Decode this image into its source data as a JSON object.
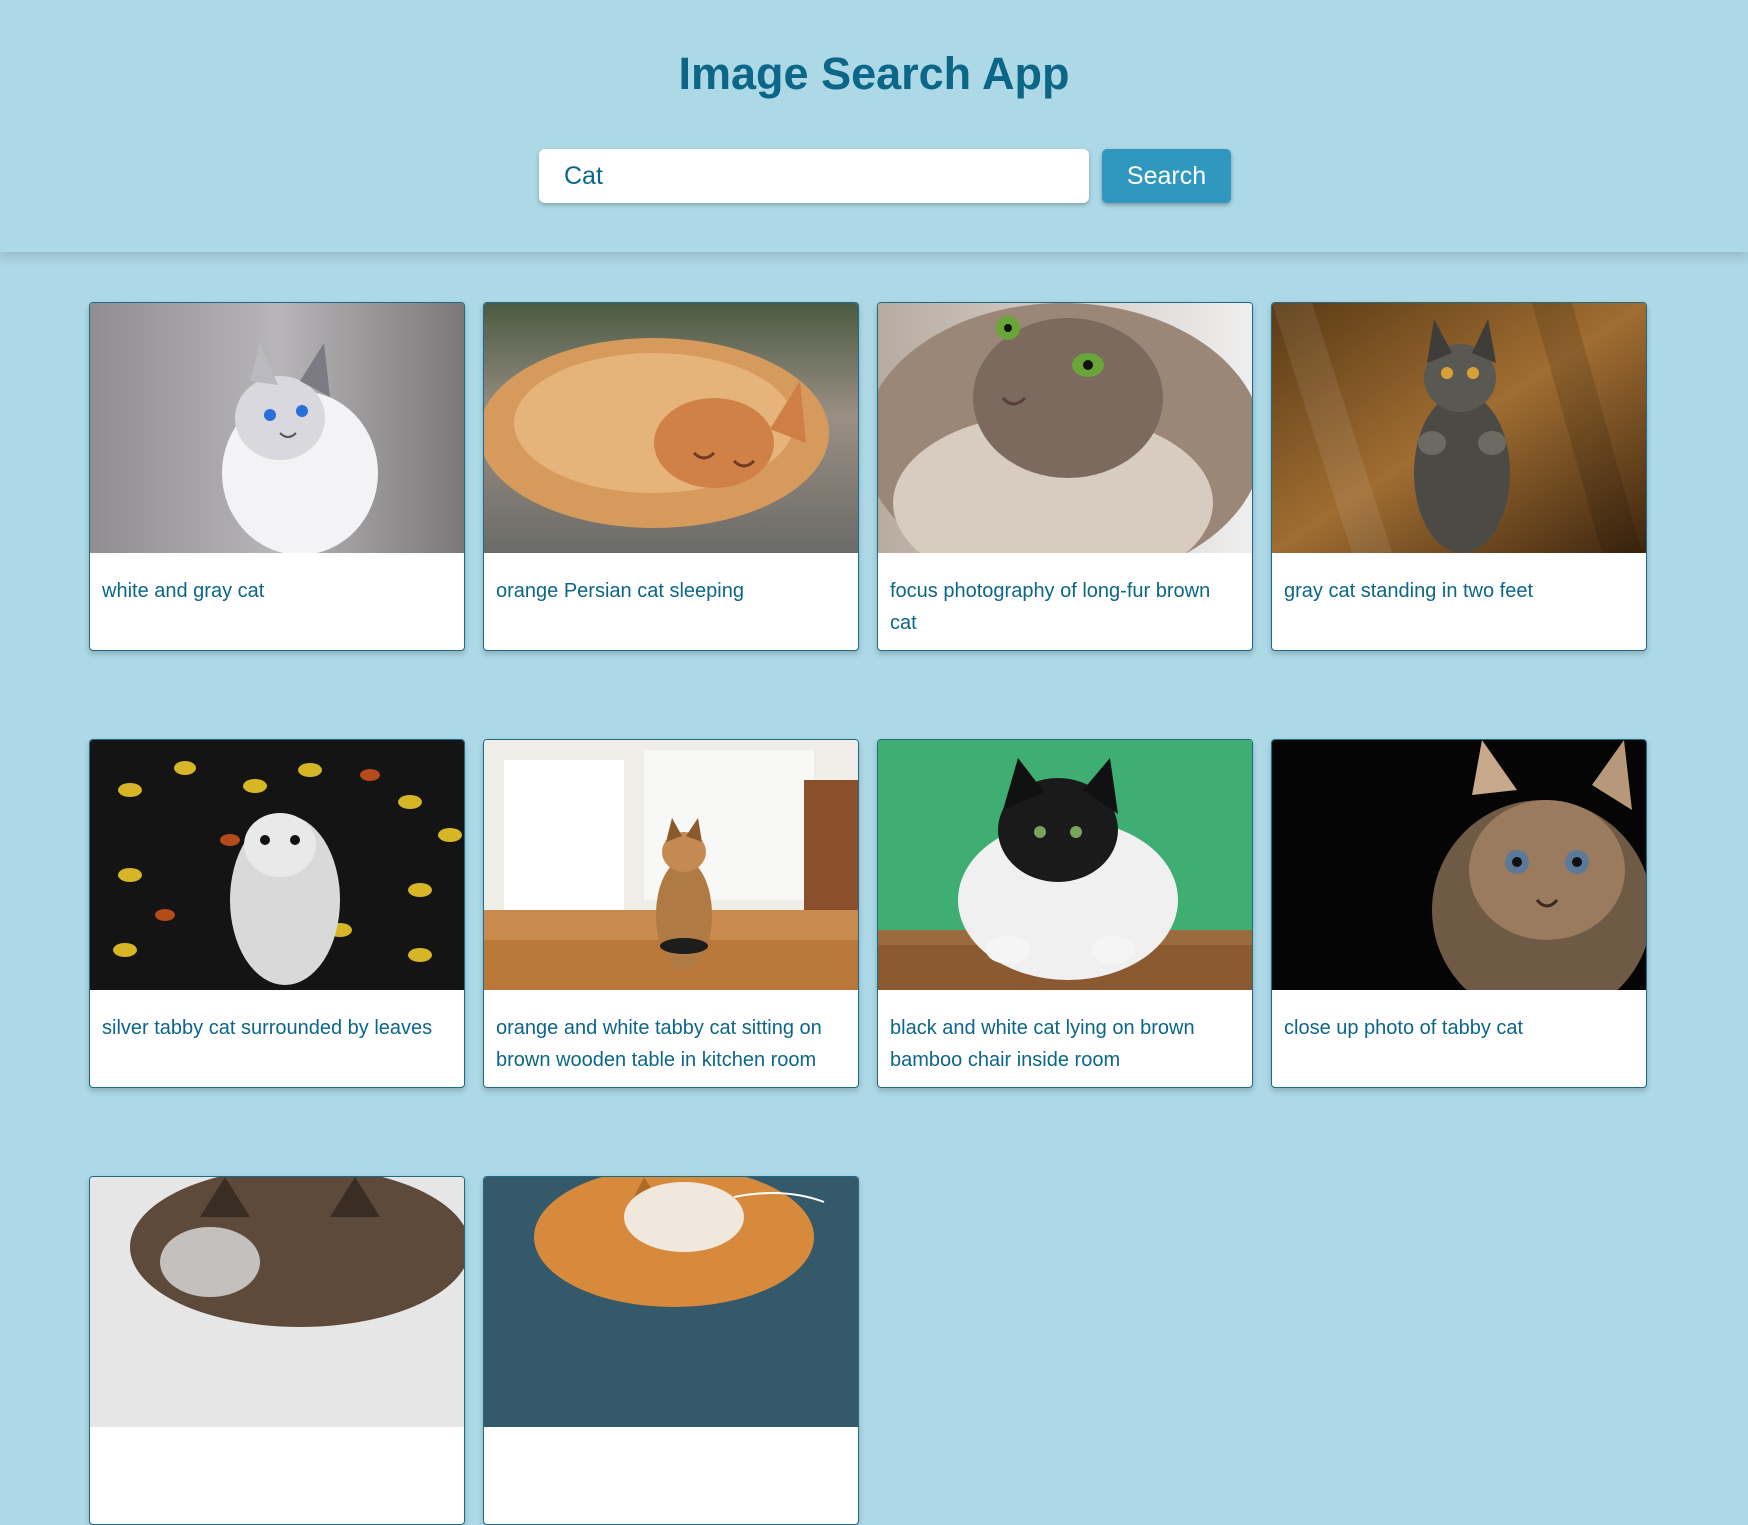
{
  "app": {
    "title": "Image Search App"
  },
  "search": {
    "value": "Cat",
    "button_label": "Search"
  },
  "results": [
    {
      "caption": "white and gray cat",
      "colors": [
        "#9b9b9f",
        "#d8d6d8",
        "#f1f1f3"
      ]
    },
    {
      "caption": "orange Persian cat sleeping",
      "colors": [
        "#d49a63",
        "#ec c89a",
        "#7f7a6d"
      ]
    },
    {
      "caption": "focus photography of long-fur brown cat",
      "colors": [
        "#8f7d70",
        "#c7b7a8",
        "#dcd1c8"
      ]
    },
    {
      "caption": "gray cat standing in two feet",
      "colors": [
        "#6e4a1c",
        "#9c6c30",
        "#4a4a45"
      ]
    },
    {
      "caption": "silver tabby cat surrounded by leaves",
      "colors": [
        "#121212",
        "#d6b627",
        "#d9d9d9"
      ]
    },
    {
      "caption": "orange and white tabby cat sitting on brown wooden table in kitchen room",
      "colors": [
        "#f0ede7",
        "#c58b4d",
        "#b07a44"
      ]
    },
    {
      "caption": "black and white cat lying on brown bamboo chair inside room",
      "colors": [
        "#3fae73",
        "#9c6b3d",
        "#f0f0f0"
      ]
    },
    {
      "caption": "close up photo of tabby cat",
      "colors": [
        "#050505",
        "#9a7b5d",
        "#d8c1a5"
      ]
    },
    {
      "caption": "",
      "colors": [
        "#e7e6e6",
        "#5d4a3a",
        "#d6d3d2"
      ]
    },
    {
      "caption": "",
      "colors": [
        "#33596a",
        "#d78a3c",
        "#f0e7dd"
      ]
    }
  ]
}
